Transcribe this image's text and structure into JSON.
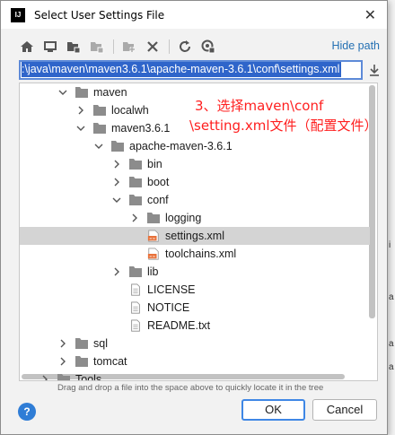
{
  "window": {
    "app_icon": "IJ",
    "title": "Select User Settings File",
    "close_glyph": "✕"
  },
  "toolbar": {
    "buttons": [
      "home-icon",
      "desktop-icon",
      "project-folder-icon",
      "module-folder-icon",
      "new-folder-icon",
      "delete-icon",
      "refresh-icon",
      "show-hidden-icon"
    ],
    "hide_path_label": "Hide path"
  },
  "path": {
    "value": ":\\java\\maven\\maven3.6.1\\apache-maven-3.6.1\\conf\\settings.xml"
  },
  "tree": {
    "rows": [
      {
        "label": "maven",
        "type": "folder",
        "expanded": true,
        "depth": 0
      },
      {
        "label": "localwh",
        "type": "folder",
        "expanded": false,
        "depth": 1
      },
      {
        "label": "maven3.6.1",
        "type": "folder",
        "expanded": true,
        "depth": 1
      },
      {
        "label": "apache-maven-3.6.1",
        "type": "folder",
        "expanded": true,
        "depth": 2
      },
      {
        "label": "bin",
        "type": "folder",
        "expanded": false,
        "depth": 3
      },
      {
        "label": "boot",
        "type": "folder",
        "expanded": false,
        "depth": 3
      },
      {
        "label": "conf",
        "type": "folder",
        "expanded": true,
        "depth": 3
      },
      {
        "label": "logging",
        "type": "folder",
        "expanded": false,
        "depth": 4
      },
      {
        "label": "settings.xml",
        "type": "xml",
        "depth": 4,
        "selected": true
      },
      {
        "label": "toolchains.xml",
        "type": "xml",
        "depth": 4
      },
      {
        "label": "lib",
        "type": "folder",
        "expanded": false,
        "depth": 3
      },
      {
        "label": "LICENSE",
        "type": "file",
        "depth": 3
      },
      {
        "label": "NOTICE",
        "type": "file",
        "depth": 3
      },
      {
        "label": "README.txt",
        "type": "file",
        "depth": 3
      },
      {
        "label": "sql",
        "type": "folder",
        "expanded": false,
        "depth": 0
      },
      {
        "label": "tomcat",
        "type": "folder",
        "expanded": false,
        "depth": 0
      },
      {
        "label": "Tools",
        "type": "folder",
        "expanded": false,
        "depth": -1
      }
    ]
  },
  "annotation": {
    "line1": "3、选择maven\\conf",
    "line2": "\\setting.xml文件（配置文件）",
    "color": "#ff1f1f"
  },
  "hint": "Drag and drop a file into the space above to quickly locate it in the tree",
  "buttons": {
    "help": "?",
    "ok": "OK",
    "cancel": "Cancel"
  },
  "background": {
    "left_text_1": "y",
    "left_text_2": "ie",
    "right_letters": [
      "i",
      "a",
      "a",
      "a"
    ]
  }
}
